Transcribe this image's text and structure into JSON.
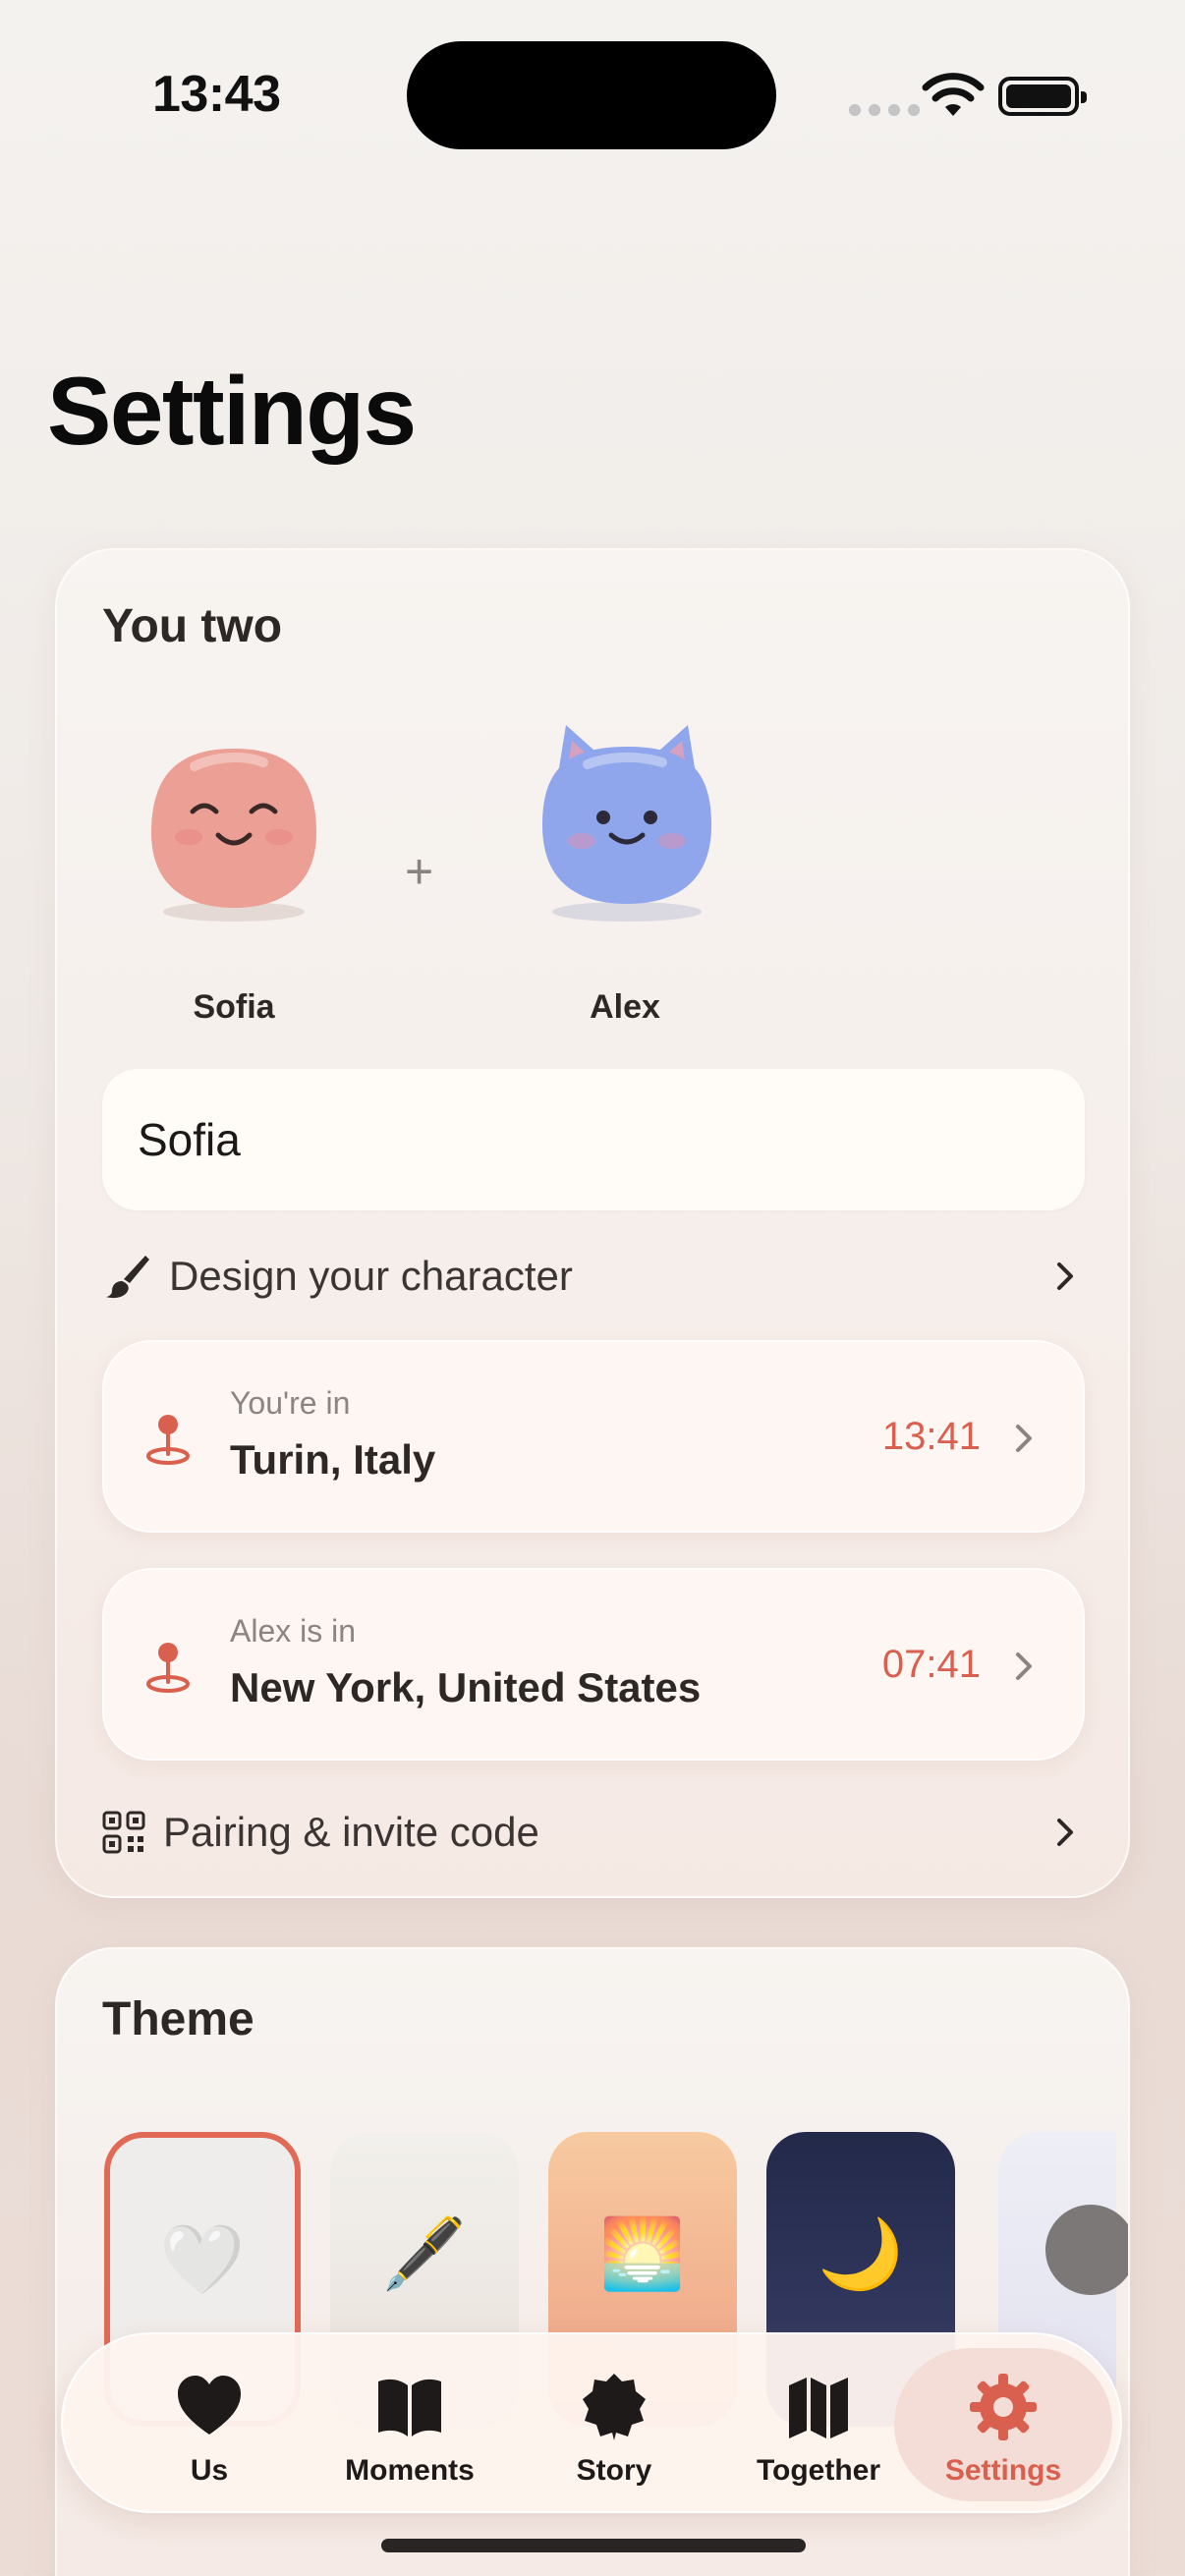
{
  "status_bar": {
    "time": "13:43"
  },
  "page": {
    "title": "Settings"
  },
  "you_two": {
    "title": "You two",
    "plus": "+",
    "partner_a": {
      "name": "Sofia"
    },
    "partner_b": {
      "name": "Alex"
    },
    "name_field_value": "Sofia",
    "design_character_label": "Design your character",
    "locations": [
      {
        "subtitle": "You're in",
        "place": "Turin, Italy",
        "time": "13:41"
      },
      {
        "subtitle": "Alex is in",
        "place": "New York, United States",
        "time": "07:41"
      }
    ],
    "pairing_label": "Pairing & invite code"
  },
  "theme": {
    "title": "Theme",
    "tiles": [
      {
        "emoji": "🤍",
        "selected": true
      },
      {
        "emoji": "🖋️",
        "selected": false
      },
      {
        "emoji": "🌅",
        "selected": false
      },
      {
        "emoji": "🌙",
        "selected": false
      }
    ]
  },
  "tabbar": {
    "items": [
      {
        "label": "Us",
        "icon": "heart-icon"
      },
      {
        "label": "Moments",
        "icon": "book-icon"
      },
      {
        "label": "Story",
        "icon": "badge-icon"
      },
      {
        "label": "Together",
        "icon": "map-icon"
      },
      {
        "label": "Settings",
        "icon": "gear-icon",
        "active": true
      }
    ]
  },
  "colors": {
    "accent": "#d9604e",
    "avatar_sofia": "#ec9f94",
    "avatar_alex": "#8fa6ec"
  }
}
